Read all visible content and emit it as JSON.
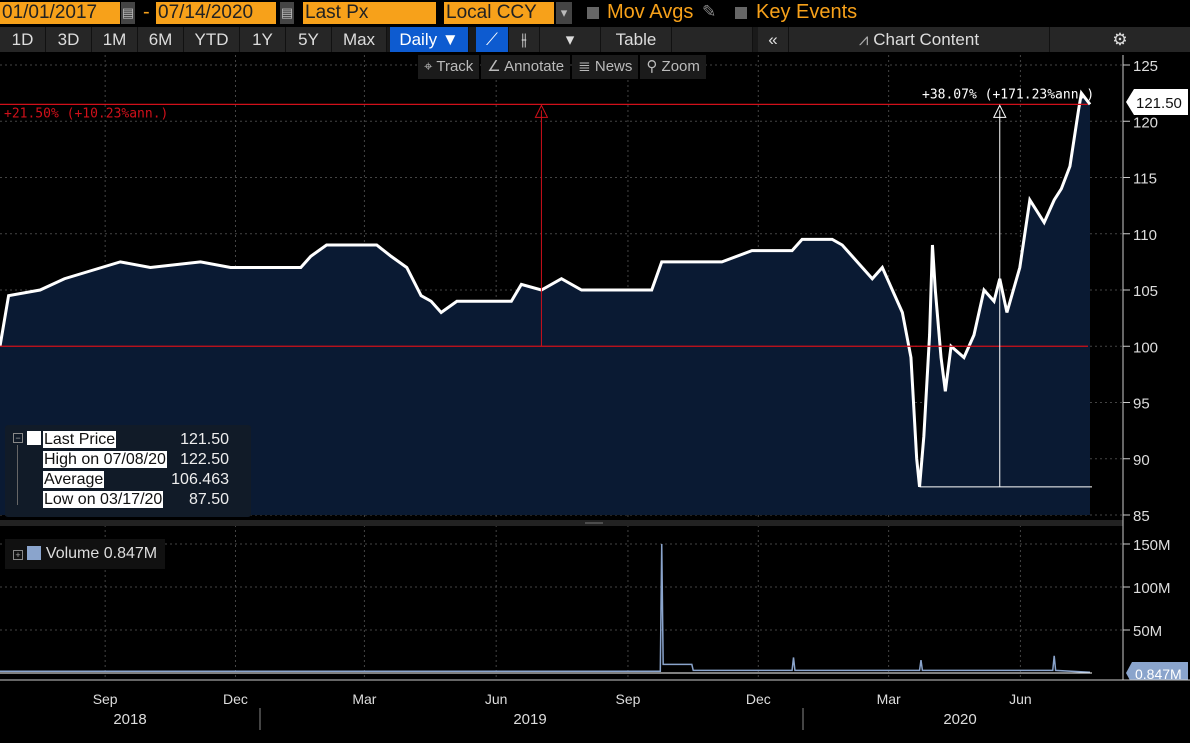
{
  "toolbar": {
    "start_date": "01/01/2017",
    "dash": "-",
    "end_date": "07/14/2020",
    "field": "Last Px",
    "currency": "Local CCY",
    "mov_avgs": "Mov Avgs",
    "key_events": "Key Events"
  },
  "ranges": [
    "1D",
    "3D",
    "1M",
    "6M",
    "YTD",
    "1Y",
    "5Y",
    "Max"
  ],
  "periodicity": "Daily ▼",
  "table_label": "Table",
  "collapse": "«",
  "chart_content": "Chart Content",
  "gear": "⚙",
  "tools": {
    "track": "⌖ Track",
    "annotate": "∠ Annotate",
    "news": "≣ News",
    "zoom": "⚲ Zoom"
  },
  "legend": {
    "last_label": "Last Price",
    "last_value": "121.50",
    "high_label": "High on 07/08/20",
    "high_value": "122.50",
    "avg_label": "Average",
    "avg_value": "106.463",
    "low_label": "Low on 03/17/20",
    "low_value": "87.50"
  },
  "volume_legend": "Volume 0.847M",
  "colors": {
    "area": "#0a1a33",
    "line": "#ffffff",
    "annot": "#d0101a",
    "volume": "#8aa4cc",
    "orange": "#f7a11a"
  },
  "chart_data": {
    "type": "area",
    "price_axis": {
      "ticks": [
        85,
        90,
        95,
        100,
        105,
        110,
        115,
        120,
        125
      ],
      "range": [
        85,
        125
      ]
    },
    "volume_axis": {
      "ticks": [
        "50M",
        "100M",
        "150M"
      ],
      "tick_values": [
        50,
        100,
        150
      ],
      "range": [
        0,
        150
      ]
    },
    "x_range": [
      "2018-06-14",
      "2020-07-14"
    ],
    "month_labels": [
      {
        "d": "2018-09-01",
        "t": "Sep"
      },
      {
        "d": "2018-12-01",
        "t": "Dec"
      },
      {
        "d": "2019-03-01",
        "t": "Mar"
      },
      {
        "d": "2019-06-01",
        "t": "Jun"
      },
      {
        "d": "2019-09-01",
        "t": "Sep"
      },
      {
        "d": "2019-12-01",
        "t": "Dec"
      },
      {
        "d": "2020-03-01",
        "t": "Mar"
      },
      {
        "d": "2020-06-01",
        "t": "Jun"
      }
    ],
    "year_labels": [
      "2018",
      "2019",
      "2020"
    ],
    "last_price_tag": "121.50",
    "last_volume_tag": "0.847M",
    "price": [
      [
        "2018-06-14",
        100
      ],
      [
        "2018-06-20",
        104.5
      ],
      [
        "2018-07-12",
        105
      ],
      [
        "2018-07-29",
        106
      ],
      [
        "2018-09-06",
        107.5
      ],
      [
        "2018-09-27",
        107
      ],
      [
        "2018-11-01",
        107.5
      ],
      [
        "2018-11-22",
        107
      ],
      [
        "2019-01-10",
        107
      ],
      [
        "2019-01-17",
        108
      ],
      [
        "2019-01-28",
        109
      ],
      [
        "2019-03-04",
        109
      ],
      [
        "2019-03-14",
        108
      ],
      [
        "2019-03-25",
        107
      ],
      [
        "2019-04-04",
        104.5
      ],
      [
        "2019-04-11",
        104
      ],
      [
        "2019-04-18",
        103
      ],
      [
        "2019-04-29",
        104
      ],
      [
        "2019-06-06",
        104
      ],
      [
        "2019-06-13",
        105.5
      ],
      [
        "2019-06-27",
        105
      ],
      [
        "2019-07-11",
        106
      ],
      [
        "2019-07-25",
        105
      ],
      [
        "2019-09-12",
        105
      ],
      [
        "2019-09-19",
        107.5
      ],
      [
        "2019-10-31",
        107.5
      ],
      [
        "2019-11-21",
        108.5
      ],
      [
        "2019-12-19",
        108.5
      ],
      [
        "2019-12-26",
        109.5
      ],
      [
        "2020-01-16",
        109.5
      ],
      [
        "2020-01-23",
        109
      ],
      [
        "2020-02-06",
        107
      ],
      [
        "2020-02-13",
        106
      ],
      [
        "2020-02-20",
        107
      ],
      [
        "2020-03-05",
        103
      ],
      [
        "2020-03-11",
        99
      ],
      [
        "2020-03-15",
        90
      ],
      [
        "2020-03-17",
        87.5
      ],
      [
        "2020-03-20",
        92
      ],
      [
        "2020-03-24",
        101
      ],
      [
        "2020-03-26",
        109
      ],
      [
        "2020-03-28",
        105
      ],
      [
        "2020-04-01",
        99
      ],
      [
        "2020-04-04",
        96
      ],
      [
        "2020-04-08",
        100
      ],
      [
        "2020-04-17",
        99
      ],
      [
        "2020-04-24",
        101
      ],
      [
        "2020-05-01",
        105
      ],
      [
        "2020-05-08",
        104
      ],
      [
        "2020-05-12",
        106
      ],
      [
        "2020-05-17",
        103
      ],
      [
        "2020-05-26",
        107
      ],
      [
        "2020-06-02",
        113
      ],
      [
        "2020-06-12",
        111
      ],
      [
        "2020-06-19",
        113
      ],
      [
        "2020-06-24",
        114
      ],
      [
        "2020-06-30",
        116
      ],
      [
        "2020-07-06",
        121
      ],
      [
        "2020-07-08",
        122.5
      ],
      [
        "2020-07-14",
        121.5
      ]
    ],
    "volume": [
      [
        "2018-06-14",
        2
      ],
      [
        "2019-09-18",
        2
      ],
      [
        "2019-09-19",
        150
      ],
      [
        "2019-09-20",
        10
      ],
      [
        "2019-10-10",
        10
      ],
      [
        "2019-10-11",
        3
      ],
      [
        "2019-12-19",
        3
      ],
      [
        "2019-12-20",
        18
      ],
      [
        "2019-12-21",
        3
      ],
      [
        "2020-03-17",
        3
      ],
      [
        "2020-03-18",
        15
      ],
      [
        "2020-03-19",
        3
      ],
      [
        "2020-06-18",
        3
      ],
      [
        "2020-06-19",
        20
      ],
      [
        "2020-06-20",
        3
      ],
      [
        "2020-07-14",
        0.847
      ]
    ],
    "annotations": [
      {
        "label": "+21.50% (+10.23%ann.)",
        "from": 100,
        "to": 121.5,
        "date": "2019-06-27",
        "color": "red"
      },
      {
        "label": "+38.07% (+171.23%ann.)",
        "from": 87.5,
        "to": 121.5,
        "date": "2020-05-12",
        "color": "white"
      }
    ]
  }
}
